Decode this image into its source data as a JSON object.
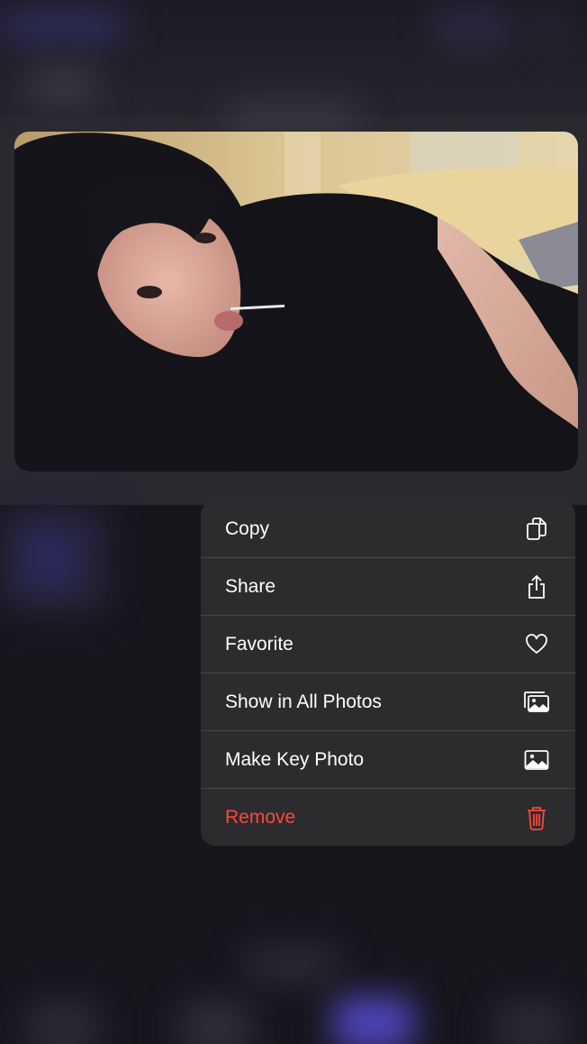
{
  "menu": {
    "items": [
      {
        "label": "Copy",
        "icon": "copy-icon"
      },
      {
        "label": "Share",
        "icon": "share-icon"
      },
      {
        "label": "Favorite",
        "icon": "heart-icon"
      },
      {
        "label": "Show in All Photos",
        "icon": "photos-stack-icon"
      },
      {
        "label": "Make Key Photo",
        "icon": "photo-icon"
      },
      {
        "label": "Remove",
        "icon": "trash-icon",
        "destructive": true
      }
    ]
  },
  "colors": {
    "menu_bg": "#2c2c2e",
    "separator": "#48484a",
    "text": "#ffffff",
    "destructive": "#ff453a",
    "background": "#17161d"
  }
}
